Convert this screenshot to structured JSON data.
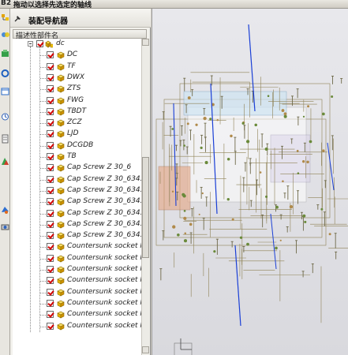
{
  "titlebar": {
    "app_id": "B2",
    "hint": "拖动以选择先选定的轴线"
  },
  "navigator": {
    "title": "装配导航器",
    "column_header": "描述性部件名",
    "root": {
      "label": "dc",
      "checked": true
    },
    "items": [
      {
        "label": "DC",
        "checked": true
      },
      {
        "label": "TF",
        "checked": true
      },
      {
        "label": "DWX",
        "checked": true
      },
      {
        "label": "ZTS",
        "checked": true
      },
      {
        "label": "FWG",
        "checked": true
      },
      {
        "label": "TBDT",
        "checked": true
      },
      {
        "label": "ZCZ",
        "checked": true
      },
      {
        "label": "LJD",
        "checked": true
      },
      {
        "label": "DCGDB",
        "checked": true
      },
      {
        "label": "TB",
        "checked": true
      },
      {
        "label": "Cap Screw Z 30_6",
        "checked": true
      },
      {
        "label": "Cap Screw Z 30_634...",
        "checked": true
      },
      {
        "label": "Cap Screw Z 30_634...",
        "checked": true
      },
      {
        "label": "Cap Screw Z 30_634...",
        "checked": true
      },
      {
        "label": "Cap Screw Z 30_634...",
        "checked": true
      },
      {
        "label": "Cap Screw Z 30_634...",
        "checked": true
      },
      {
        "label": "Cap Screw Z 30_634...",
        "checked": true
      },
      {
        "label": "Countersunk socket h...",
        "checked": true
      },
      {
        "label": "Countersunk socket h...",
        "checked": true
      },
      {
        "label": "Countersunk socket h...",
        "checked": true
      },
      {
        "label": "Countersunk socket h...",
        "checked": true
      },
      {
        "label": "Countersunk socket h...",
        "checked": true
      },
      {
        "label": "Countersunk socket h...",
        "checked": true
      },
      {
        "label": "Countersunk socket h...",
        "checked": true
      },
      {
        "label": "Countersunk socket h...",
        "checked": true
      }
    ]
  },
  "resource_bar": {
    "icons": [
      "assembly-navigator-icon",
      "constraint-navigator-icon",
      "part-navigator-icon",
      "reuse-library-icon",
      "web-browser-icon",
      "history-icon",
      "process-studio-icon",
      "roles-icon",
      "system-materials-icon",
      "system-scenes-icon"
    ]
  },
  "viewport": {
    "background": "#e0e0e4",
    "axis_color": "#1a3fd6"
  }
}
